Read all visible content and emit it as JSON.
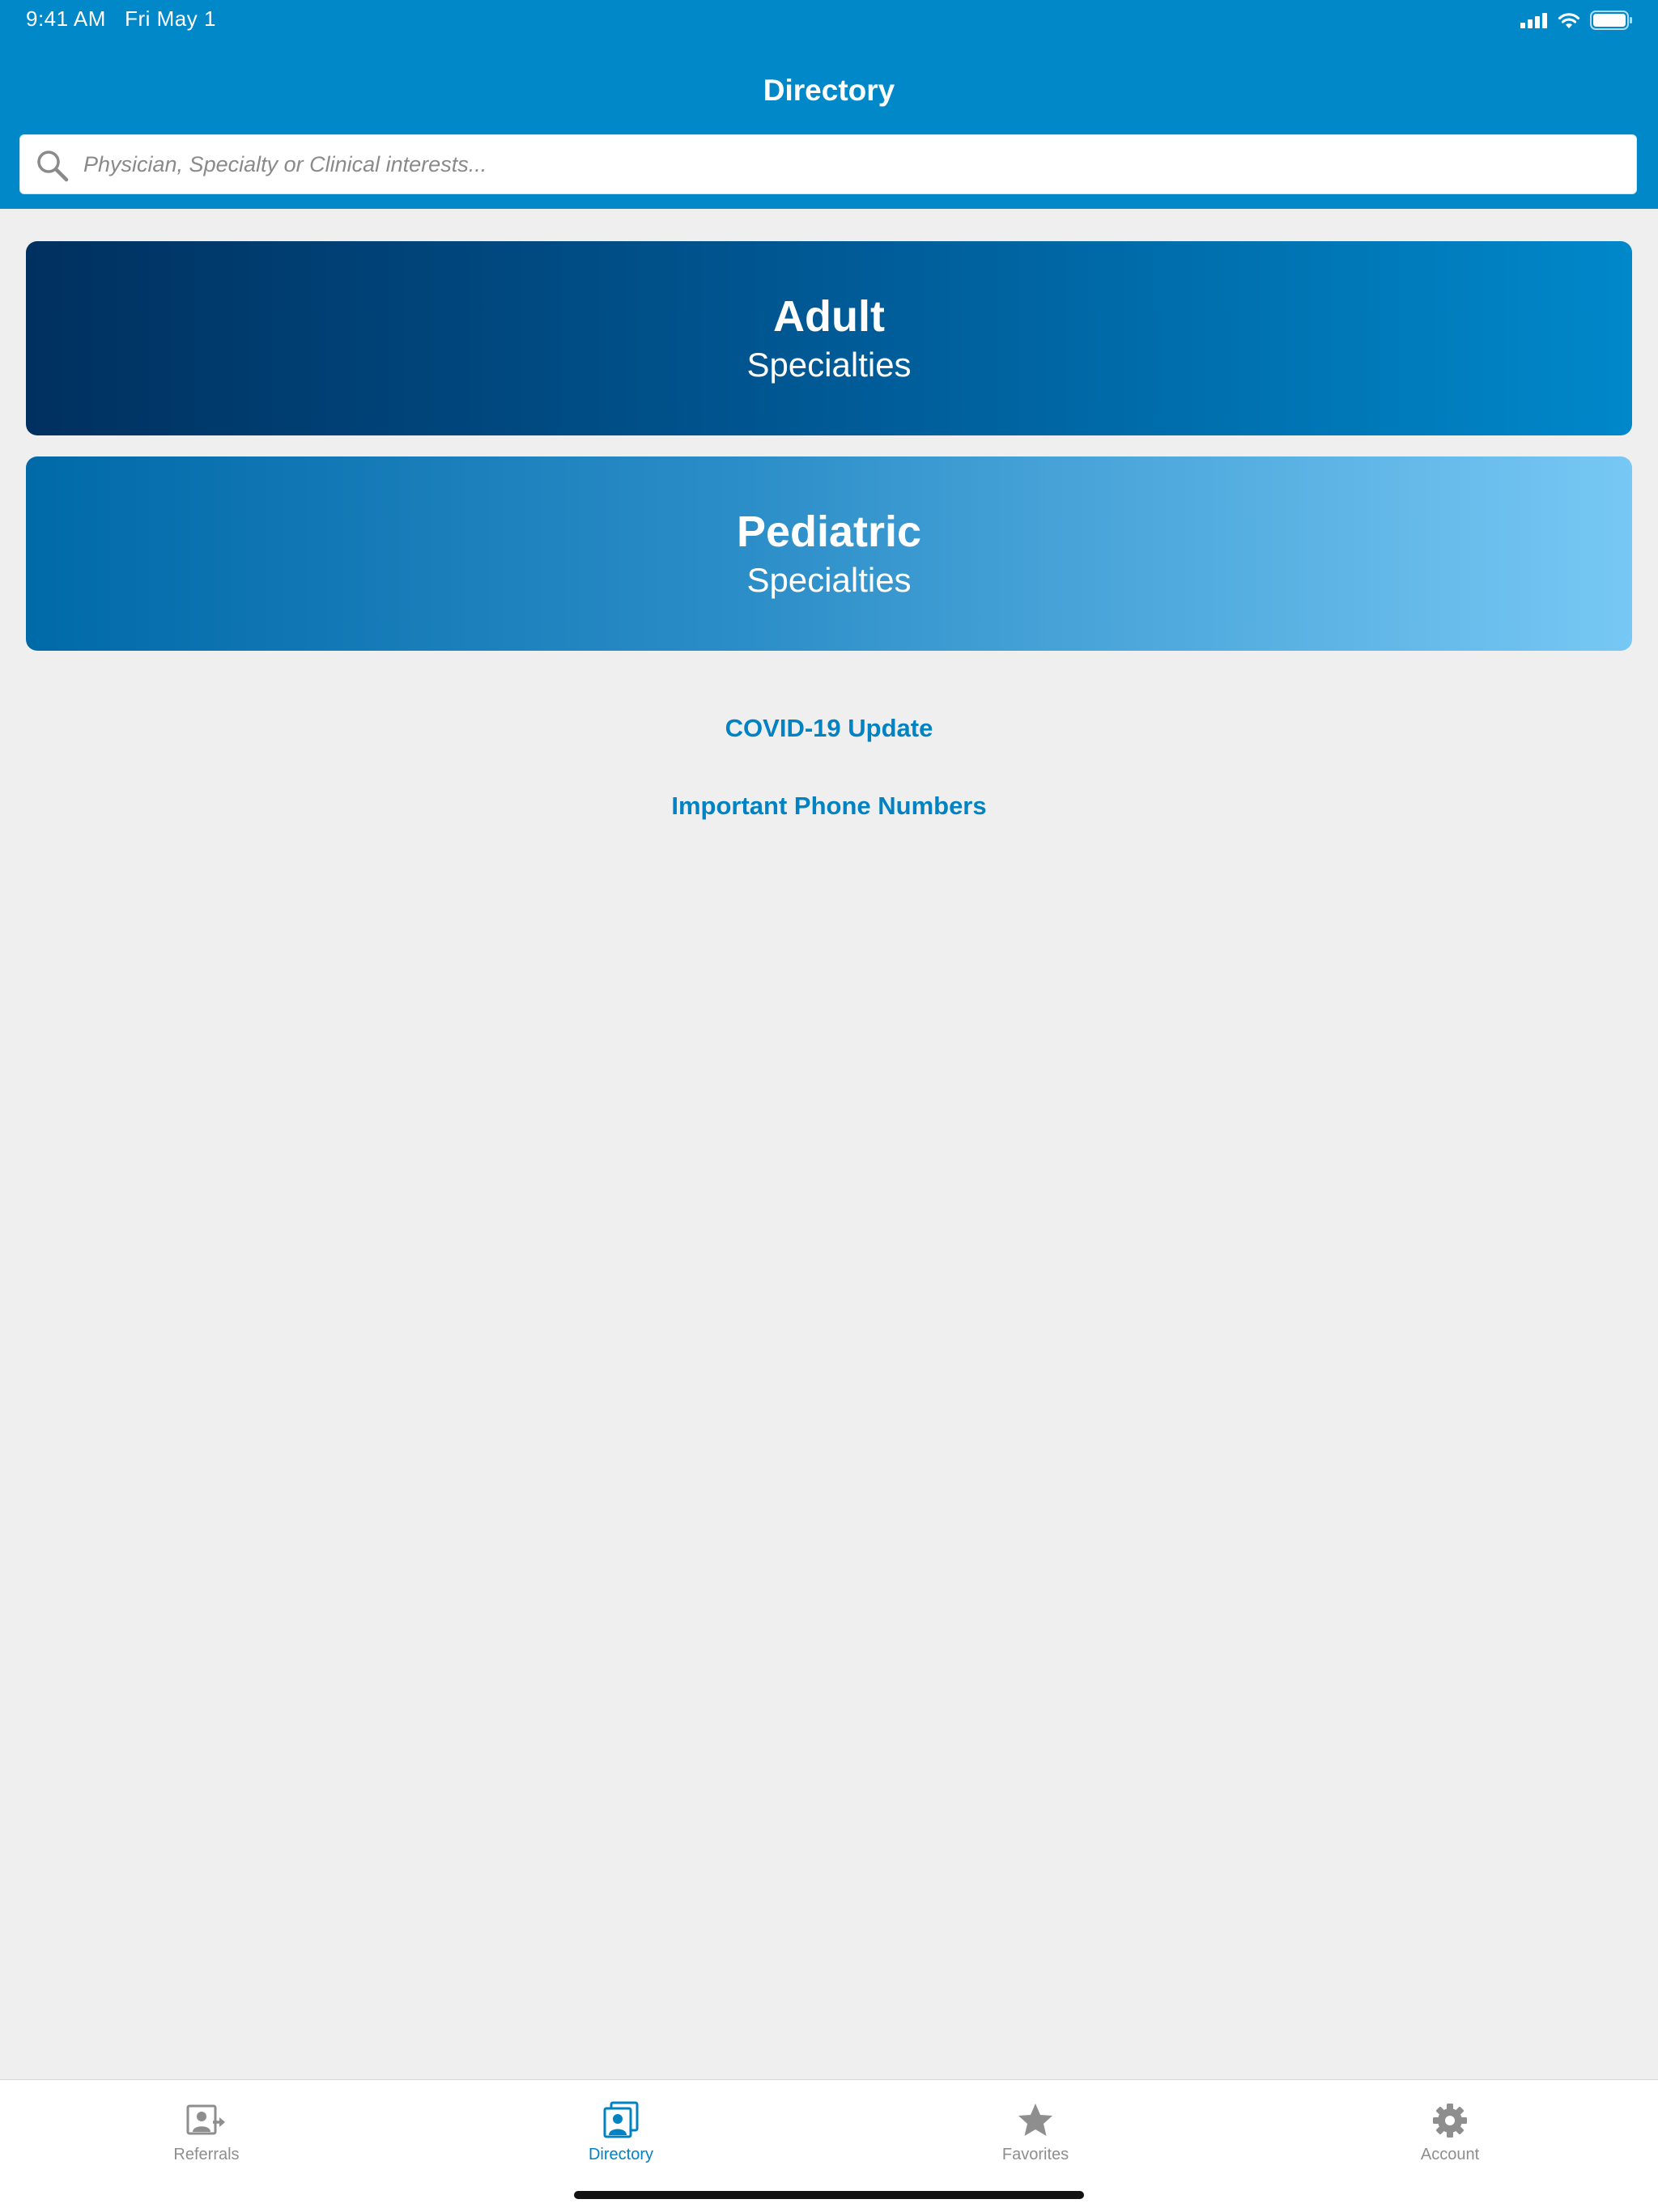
{
  "status_bar": {
    "time": "9:41 AM",
    "date": "Fri May 1"
  },
  "nav": {
    "title": "Directory"
  },
  "search": {
    "placeholder": "Physician, Specialty or Clinical interests...",
    "value": ""
  },
  "cards": [
    {
      "title": "Adult",
      "subtitle": "Specialties"
    },
    {
      "title": "Pediatric",
      "subtitle": "Specialties"
    }
  ],
  "links": [
    {
      "label": "COVID-19 Update"
    },
    {
      "label": "Important Phone Numbers"
    }
  ],
  "tabs": [
    {
      "label": "Referrals",
      "icon": "referrals-icon"
    },
    {
      "label": "Directory",
      "icon": "directory-icon",
      "active": true
    },
    {
      "label": "Favorites",
      "icon": "star-icon"
    },
    {
      "label": "Account",
      "icon": "gear-icon"
    }
  ],
  "colors": {
    "brand_blue": "#0088c9",
    "link_blue": "#0082c3",
    "background": "#efefef",
    "inactive_gray": "#8e8e8e"
  }
}
